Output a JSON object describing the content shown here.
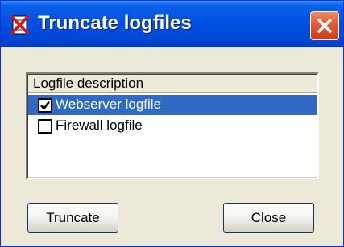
{
  "window": {
    "title": "Truncate logfiles",
    "title_icon": "logfile-truncate-icon",
    "close_icon": "close-icon"
  },
  "colors": {
    "titlebar": "#0050e0",
    "frame": "#ece9d8",
    "selection": "#316ac5",
    "close_button": "#e25a2f"
  },
  "list": {
    "column_header": "Logfile description",
    "rows": [
      {
        "label": "Webserver logfile",
        "checked": true,
        "selected": true
      },
      {
        "label": "Firewall logfile",
        "checked": false,
        "selected": false
      }
    ]
  },
  "buttons": {
    "truncate": "Truncate",
    "close": "Close"
  }
}
